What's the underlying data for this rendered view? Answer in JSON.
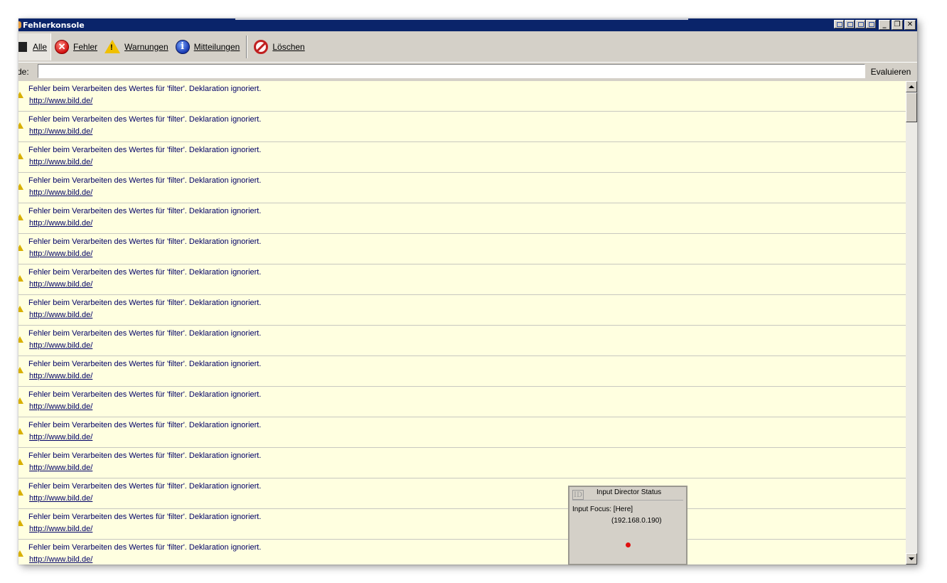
{
  "window": {
    "title": "Fehlerkonsole"
  },
  "toolbar": {
    "all_label": "Alle",
    "errors_label": "Fehler",
    "warnings_label": "Warnungen",
    "messages_label": "Mitteilungen",
    "clear_label": "Löschen"
  },
  "codebar": {
    "label": "de:",
    "input_value": "",
    "evaluate_label": "Evaluieren"
  },
  "entries": [
    {
      "message": "Fehler beim Verarbeiten des Wertes für 'filter'.  Deklaration ignoriert.",
      "source": "http://www.bild.de/"
    },
    {
      "message": "Fehler beim Verarbeiten des Wertes für 'filter'.  Deklaration ignoriert.",
      "source": "http://www.bild.de/"
    },
    {
      "message": "Fehler beim Verarbeiten des Wertes für 'filter'.  Deklaration ignoriert.",
      "source": "http://www.bild.de/"
    },
    {
      "message": "Fehler beim Verarbeiten des Wertes für 'filter'.  Deklaration ignoriert.",
      "source": "http://www.bild.de/"
    },
    {
      "message": "Fehler beim Verarbeiten des Wertes für 'filter'.  Deklaration ignoriert.",
      "source": "http://www.bild.de/"
    },
    {
      "message": "Fehler beim Verarbeiten des Wertes für 'filter'.  Deklaration ignoriert.",
      "source": "http://www.bild.de/"
    },
    {
      "message": "Fehler beim Verarbeiten des Wertes für 'filter'.  Deklaration ignoriert.",
      "source": "http://www.bild.de/"
    },
    {
      "message": "Fehler beim Verarbeiten des Wertes für 'filter'.  Deklaration ignoriert.",
      "source": "http://www.bild.de/"
    },
    {
      "message": "Fehler beim Verarbeiten des Wertes für 'filter'.  Deklaration ignoriert.",
      "source": "http://www.bild.de/"
    },
    {
      "message": "Fehler beim Verarbeiten des Wertes für 'filter'.  Deklaration ignoriert.",
      "source": "http://www.bild.de/"
    },
    {
      "message": "Fehler beim Verarbeiten des Wertes für 'filter'.  Deklaration ignoriert.",
      "source": "http://www.bild.de/"
    },
    {
      "message": "Fehler beim Verarbeiten des Wertes für 'filter'.  Deklaration ignoriert.",
      "source": "http://www.bild.de/"
    },
    {
      "message": "Fehler beim Verarbeiten des Wertes für 'filter'.  Deklaration ignoriert.",
      "source": "http://www.bild.de/"
    },
    {
      "message": "Fehler beim Verarbeiten des Wertes für 'filter'.  Deklaration ignoriert.",
      "source": "http://www.bild.de/"
    },
    {
      "message": "Fehler beim Verarbeiten des Wertes für 'filter'.  Deklaration ignoriert.",
      "source": "http://www.bild.de/"
    },
    {
      "message": "Fehler beim Verarbeiten des Wertes für 'filter'.  Deklaration ignoriert.",
      "source": "http://www.bild.de/"
    }
  ],
  "status_popup": {
    "icon_text": "ID",
    "title": "Input Director Status",
    "focus": "Input Focus: [Here]",
    "ip": "(192.168.0.190)",
    "indicator_color": "#e01010"
  },
  "colors": {
    "titlebar": "#0a246a",
    "list_background": "#ffffe0",
    "text": "#000066"
  }
}
